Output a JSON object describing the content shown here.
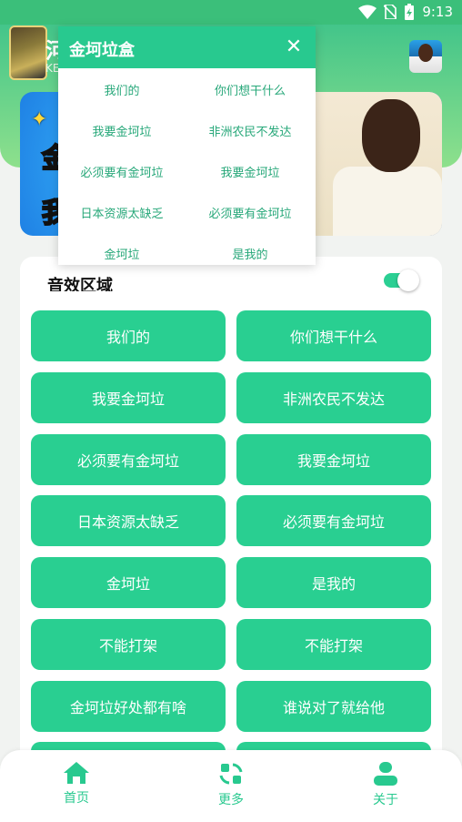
{
  "status_bar": {
    "time": "9:13"
  },
  "header": {
    "title": "河",
    "subtitle": "KEI"
  },
  "banner": {
    "text1": "金",
    "text2": "我"
  },
  "section": {
    "label": "音效区域"
  },
  "sound_buttons": [
    "我们的",
    "你们想干什么",
    "我要金坷垃",
    "非洲农民不发达",
    "必须要有金坷垃",
    "我要金坷垃",
    "日本资源太缺乏",
    "必须要有金坷垃",
    "金坷垃",
    "是我的",
    "不能打架",
    "不能打架",
    "金坷垃好处都有啥",
    "谁说对了就给他"
  ],
  "popup": {
    "title": "金坷垃盒",
    "close_icon": "close-icon",
    "items": [
      "我们的",
      "你们想干什么",
      "我要金坷垃",
      "非洲农民不发达",
      "必须要有金坷垃",
      "我要金坷垃",
      "日本资源太缺乏",
      "必须要有金坷垃",
      "金坷垃",
      "是我的"
    ]
  },
  "bottom_nav": [
    {
      "label": "首页",
      "icon": "home-icon"
    },
    {
      "label": "更多",
      "icon": "refresh-grid-icon"
    },
    {
      "label": "关于",
      "icon": "person-icon"
    }
  ],
  "colors": {
    "accent": "#28c98f",
    "header_top": "#43c58a",
    "header_bottom": "#8ee08c"
  }
}
